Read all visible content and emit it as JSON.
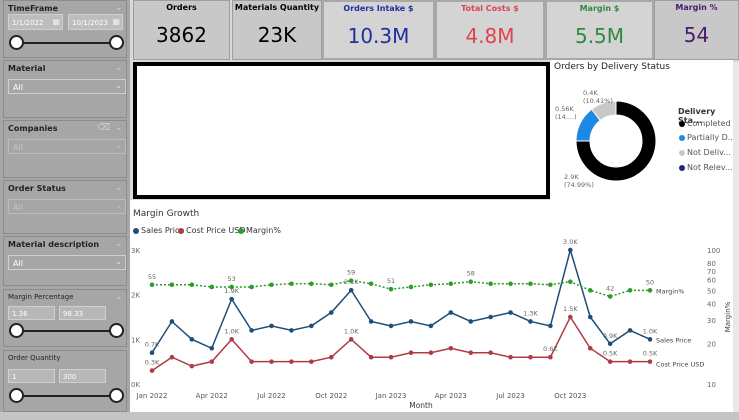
{
  "filters": {
    "timeframe": {
      "title": "TimeFrame",
      "start": "1/1/2022",
      "end": "10/1/2023"
    },
    "material": {
      "title": "Material",
      "value": "All"
    },
    "companies": {
      "title": "Companies",
      "value": "All"
    },
    "order_status": {
      "title": "Order Status",
      "value": "All"
    },
    "material_description": {
      "title": "Material description",
      "value": "All"
    },
    "margin_percentage": {
      "title": "Margin Percentage",
      "min": "1.36",
      "max": "98.33"
    },
    "order_quantity": {
      "title": "Order Quantity",
      "min": "1",
      "max": "300"
    }
  },
  "kpis": [
    {
      "title": "Orders",
      "value": "3862",
      "color": "#000000"
    },
    {
      "title": "Materials Quantity",
      "value": "23K",
      "color": "#000000"
    },
    {
      "title": "Orders Intake $",
      "value": "10.3M",
      "color": "#1f2f9e"
    },
    {
      "title": "Total Costs $",
      "value": "4.8M",
      "color": "#e0434f"
    },
    {
      "title": "Margin $",
      "value": "5.5M",
      "color": "#2f8a3f"
    },
    {
      "title": "Margin %",
      "value": "54",
      "color": "#4a1a6e"
    }
  ],
  "donut": {
    "title": "Orders by Delivery Status",
    "legend_title": "Delivery Sta...",
    "labels": {
      "not_delivered": "0.4K\n(10.41%)",
      "partial": "0.56K\n(14....)",
      "completed": "2.9K\n(74.99%)"
    },
    "legend": [
      {
        "label": "Completed",
        "color": "#000000"
      },
      {
        "label": "Partially D...",
        "color": "#1e88e5"
      },
      {
        "label": "Not Deliv...",
        "color": "#c8c8c8"
      },
      {
        "label": "Not Relev...",
        "color": "#1f2a6b"
      }
    ]
  },
  "margin_growth": {
    "title": "Margin Growth",
    "legend": [
      {
        "label": "Sales Price",
        "color": "#1f4e79"
      },
      {
        "label": "Cost Price USD",
        "color": "#b03a48"
      },
      {
        "label": "Margin%",
        "color": "#2a9d2a"
      }
    ],
    "x_axis_title": "Month",
    "y2_axis_title": "Margin%",
    "end_labels": {
      "sales": "Sales Price",
      "cost": "Cost Price USD",
      "margin": "Margin%"
    }
  },
  "chart_data": {
    "type": "line",
    "title": "Margin Growth",
    "xlabel": "Month",
    "ylabel": "",
    "y2label": "Margin%",
    "y2_scale": "log",
    "x_ticks": [
      "Jan 2022",
      "Apr 2022",
      "Jul 2022",
      "Oct 2022",
      "Jan 2023",
      "Apr 2023",
      "Jul 2023",
      "Oct 2023"
    ],
    "y_ticks": [
      "0K",
      "1K",
      "2K",
      "3K"
    ],
    "y2_ticks": [
      "10",
      "20",
      "30",
      "40",
      "50",
      "60",
      "70",
      "80",
      "100"
    ],
    "ylim": [
      0,
      3000
    ],
    "y2lim": [
      10,
      100
    ],
    "series": [
      {
        "name": "Sales Price",
        "color": "#1f4e79",
        "values": [
          700,
          1400,
          1000,
          800,
          1900,
          1200,
          1300,
          1200,
          1300,
          1600,
          2100,
          1400,
          1300,
          1400,
          1300,
          1600,
          1400,
          1500,
          1600,
          1400,
          1300,
          3000,
          1500,
          900,
          1200,
          1000
        ],
        "point_labels": {
          "0": "0.7K",
          "4": "1.9K",
          "10": "2.1K",
          "19": "1.3K",
          "21": "3.0K",
          "23": "0.9K",
          "25": "1.0K"
        }
      },
      {
        "name": "Cost Price USD",
        "color": "#b03a48",
        "values": [
          300,
          600,
          400,
          500,
          1000,
          500,
          500,
          500,
          500,
          600,
          1000,
          600,
          600,
          700,
          700,
          800,
          700,
          700,
          600,
          600,
          600,
          1500,
          800,
          500,
          500,
          500
        ],
        "point_labels": {
          "0": "0.3K",
          "4": "1.0K",
          "10": "1.0K",
          "20": "0.6K",
          "21": "1.5K",
          "23": "0.5K",
          "25": "0.5K"
        }
      },
      {
        "name": "Margin%",
        "color": "#2a9d2a",
        "axis": "y2",
        "values": [
          55,
          55,
          55,
          53,
          53,
          53,
          55,
          56,
          56,
          55,
          59,
          56,
          51,
          53,
          55,
          56,
          58,
          56,
          56,
          56,
          55,
          58,
          50,
          45,
          50,
          50
        ],
        "point_labels": {
          "0": "55",
          "4": "53",
          "10": "59",
          "12": "51",
          "16": "58",
          "23": "42",
          "25": "50"
        }
      }
    ]
  }
}
